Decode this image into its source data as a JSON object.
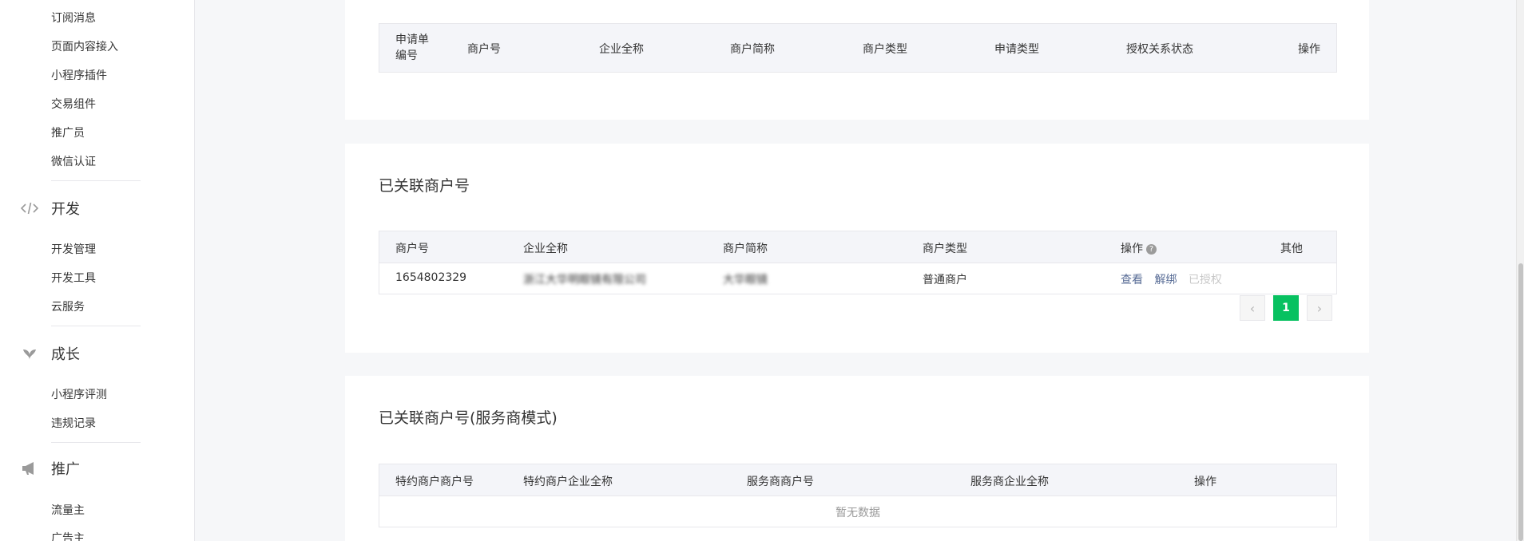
{
  "sidebar": {
    "top_items": [
      "订阅消息",
      "页面内容接入",
      "小程序插件",
      "交易组件",
      "推广员",
      "微信认证"
    ],
    "groups": [
      {
        "title": "开发",
        "icon": "code-icon",
        "items": [
          "开发管理",
          "开发工具",
          "云服务"
        ]
      },
      {
        "title": "成长",
        "icon": "leaf-icon",
        "items": [
          "小程序评测",
          "违规记录"
        ]
      },
      {
        "title": "推广",
        "icon": "megaphone-icon",
        "items": [
          "流量主",
          "广告主"
        ]
      }
    ]
  },
  "applications": {
    "columns": [
      "申请单编号",
      "商户号",
      "企业全称",
      "商户简称",
      "商户类型",
      "申请类型",
      "授权关系状态",
      "操作"
    ],
    "col_line1": "申请单",
    "col_line2": "编号"
  },
  "linked": {
    "title": "已关联商户号",
    "columns": [
      "商户号",
      "企业全称",
      "商户简称",
      "商户类型",
      "操作",
      "其他"
    ],
    "rows": [
      {
        "merchant_id": "1654802329",
        "company": "浙江大华明眼镜有限公司",
        "short_name": "大华眼镜",
        "type": "普通商户",
        "actions": [
          "查看",
          "解绑"
        ],
        "disabled_action": "已授权"
      }
    ],
    "pager": {
      "prev": "‹",
      "current": "1",
      "next": "›"
    }
  },
  "service": {
    "title": "已关联商户号(服务商模式)",
    "columns": [
      "特约商户商户号",
      "特约商户企业全称",
      "服务商商户号",
      "服务商企业全称",
      "操作"
    ],
    "empty_text": "暂无数据"
  }
}
